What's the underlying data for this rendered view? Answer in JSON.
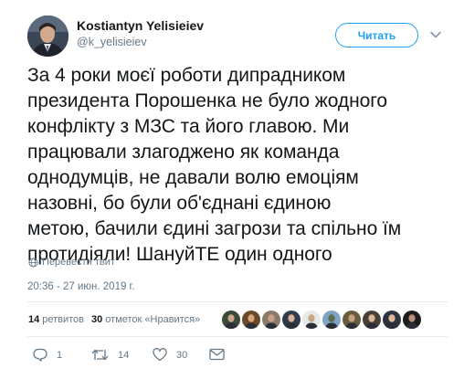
{
  "user": {
    "display_name": "Kostiantyn Yelisieiev",
    "handle": "@k_yelisieiev"
  },
  "follow_button": {
    "label": "Читать"
  },
  "tweet": {
    "lines": [
      "За 4 роки моєї роботи дипрадником",
      "президента Порошенка не було жодного",
      "конфлікту з МЗС та його главою. Ми",
      "працювали злагоджено як команда",
      "однодумців, не давали волю емоціям",
      "назовні, бо були об'єднані єдиною",
      "метою, бачили єдині загрози та спільно їм",
      "протидіяли! ШануйТЕ один одного"
    ],
    "translate_label": "Перевести твит",
    "timestamp": "20:36 - 27 июн. 2019 г."
  },
  "stats": {
    "retweets_count": "14",
    "retweets_label": "ретвитов",
    "likes_count": "30",
    "likes_label": "отметок «Нравится»"
  },
  "likers": [
    {
      "bg": "#3b4a3a",
      "skin": "#c9a88a"
    },
    {
      "bg": "#6b4a2a",
      "skin": "#d9a57c"
    },
    {
      "bg": "#8a7a6a",
      "skin": "#caa184"
    },
    {
      "bg": "#2f3a4d",
      "skin": "#d8b39a"
    },
    {
      "bg": "#e8e8e8",
      "skin": "#c9a88a"
    },
    {
      "bg": "#7fa3c2",
      "skin": "#5e6b4c"
    },
    {
      "bg": "#6a5a40",
      "skin": "#c7a07c"
    },
    {
      "bg": "#4a4036",
      "skin": "#d9b796"
    },
    {
      "bg": "#2d3440",
      "skin": "#e0b89a"
    },
    {
      "bg": "#1c1c1c",
      "skin": "#b89078"
    }
  ],
  "actions": {
    "reply_count": "1",
    "retweet_count": "14",
    "like_count": "30"
  },
  "colors": {
    "accent": "#1da1f2",
    "secondary_text": "#657786",
    "primary_text": "#14171a",
    "divider": "#e6ecf0"
  },
  "icons": [
    "chevron-down-icon",
    "globe-icon",
    "reply-icon",
    "retweet-icon",
    "heart-icon",
    "envelope-icon"
  ]
}
